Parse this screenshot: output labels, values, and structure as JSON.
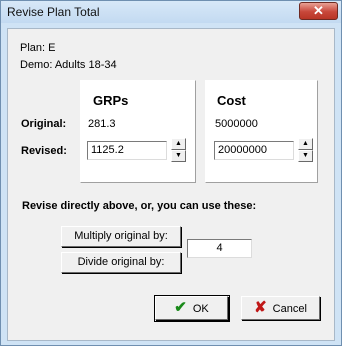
{
  "window": {
    "title": "Revise Plan Total",
    "close_symbol": "✕"
  },
  "plan": {
    "label": "Plan: E"
  },
  "demo": {
    "label": "Demo: Adults 18-34"
  },
  "row_labels": {
    "original": "Original:",
    "revised": "Revised:"
  },
  "grps": {
    "header": "GRPs",
    "original": "281.3",
    "revised": "1125.2"
  },
  "cost": {
    "header": "Cost",
    "original": "5000000",
    "revised": "20000000"
  },
  "instruction": "Revise directly above, or, you can use these:",
  "multiply_button": "Multiply original by:",
  "divide_button": "Divide original by:",
  "factor": "4",
  "ok_button": "OK",
  "cancel_button": "Cancel",
  "icons": {
    "ok": "check-icon",
    "cancel": "x-icon",
    "spin_up": "▲",
    "spin_down": "▼"
  },
  "colors": {
    "ok_check": "#1a8a1a",
    "cancel_x": "#c01818",
    "close_button": "#c8473a"
  }
}
